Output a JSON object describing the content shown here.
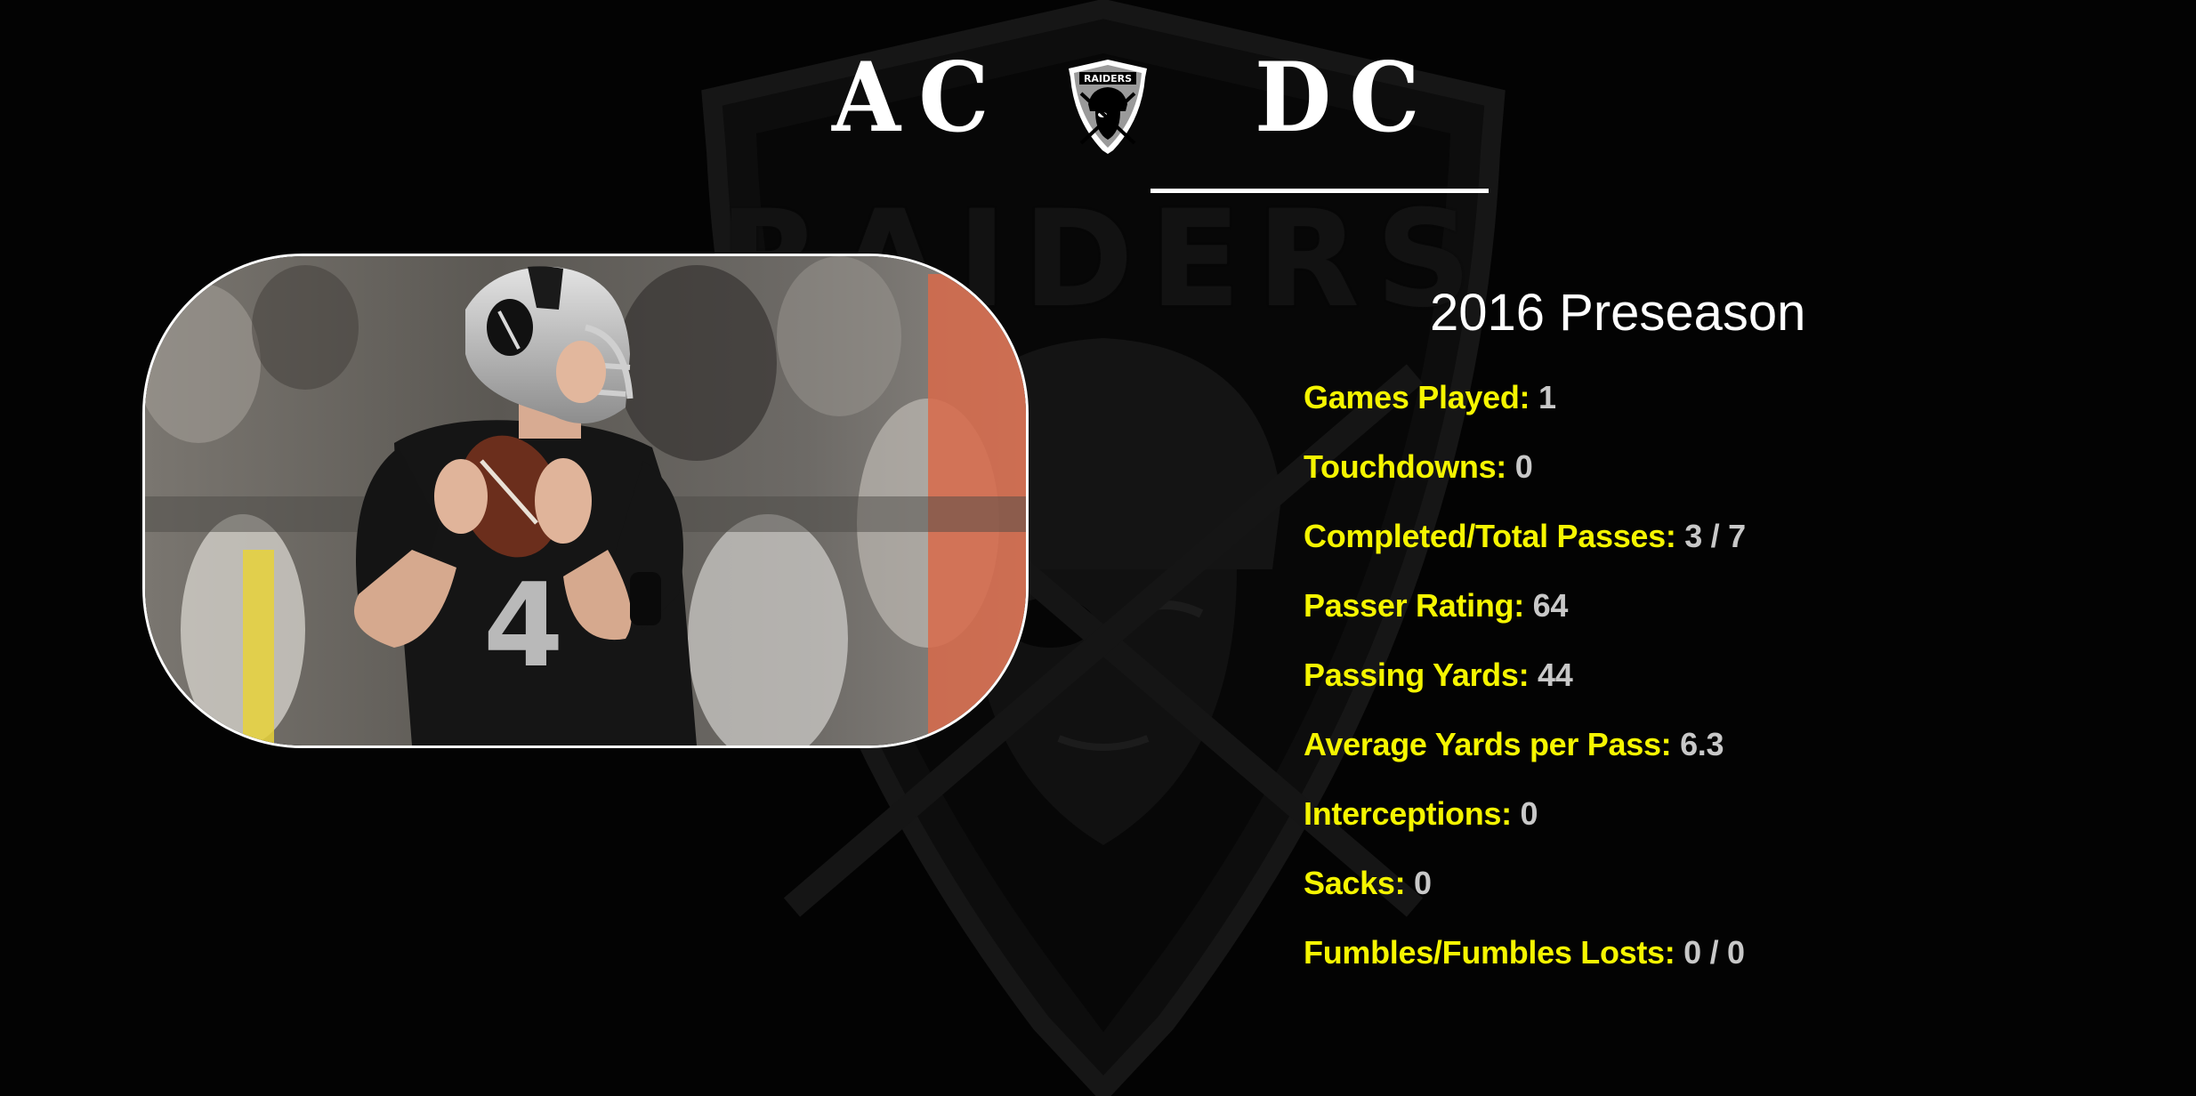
{
  "header": {
    "left_letters": "AC",
    "right_letters": "DC",
    "logo_icon": "raiders-shield-icon",
    "logo_text": "RAIDERS"
  },
  "background": {
    "watermark_icon": "raiders-shield-watermark",
    "watermark_text": "RAIDERS"
  },
  "photo": {
    "icon": "quarterback-photo",
    "jersey_number": "4"
  },
  "stats": {
    "title": "2016 Preseason",
    "rows": [
      {
        "label": "Games Played:",
        "value": "1"
      },
      {
        "label": "Touchdowns:",
        "value": "0"
      },
      {
        "label": "Completed/Total Passes:",
        "value": "3 / 7"
      },
      {
        "label": "Passer Rating:",
        "value": "64"
      },
      {
        "label": "Passing Yards:",
        "value": "44"
      },
      {
        "label": "Average Yards per Pass:",
        "value": "6.3"
      },
      {
        "label": "Interceptions:",
        "value": "0"
      },
      {
        "label": "Sacks:",
        "value": "0"
      },
      {
        "label": "Fumbles/Fumbles Losts:",
        "value": "0 / 0"
      }
    ]
  },
  "colors": {
    "background": "#030303",
    "label": "#f5f500",
    "value": "#c8c8c8",
    "title": "#ffffff"
  }
}
